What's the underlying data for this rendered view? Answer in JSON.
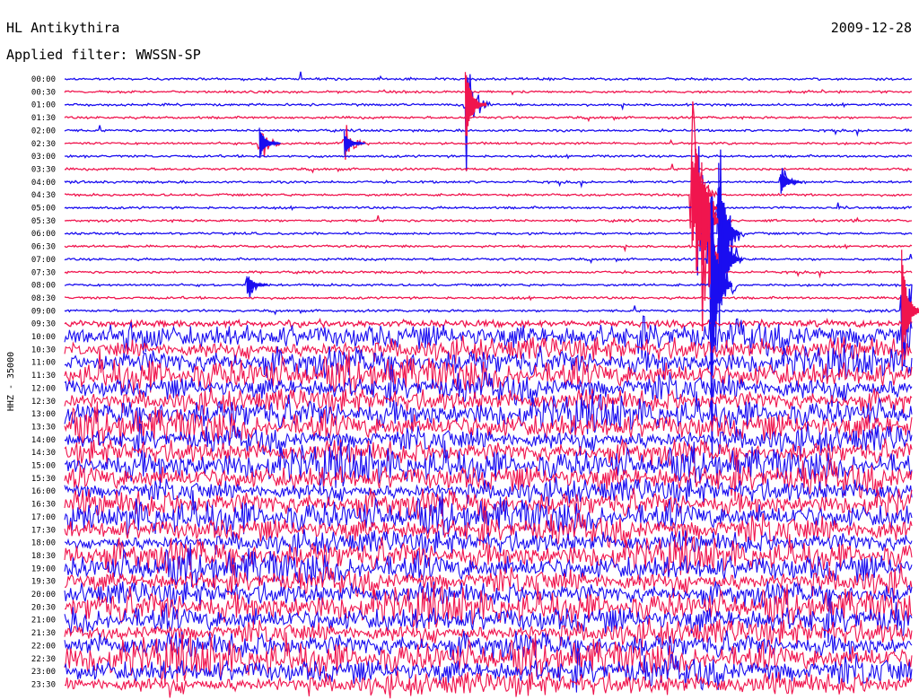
{
  "header": {
    "station": "HL Antikythira",
    "date": "2009-12-28",
    "filter": "Applied filter: WWSSN-SP"
  },
  "chart_data": {
    "type": "line",
    "subtype": "helicorder",
    "ylabel": "HHZ - 35000",
    "tick_labels": [
      "00:00",
      "00:30",
      "01:00",
      "01:30",
      "02:00",
      "02:30",
      "03:00",
      "03:30",
      "04:00",
      "04:30",
      "05:00",
      "05:30",
      "06:00",
      "06:30",
      "07:00",
      "07:30",
      "08:00",
      "08:30",
      "09:00",
      "09:30",
      "10:00",
      "10:30",
      "11:00",
      "11:30",
      "12:00",
      "12:30",
      "13:00",
      "13:30",
      "14:00",
      "14:30",
      "15:00",
      "15:30",
      "16:00",
      "16:30",
      "17:00",
      "17:30",
      "18:00",
      "18:30",
      "19:00",
      "19:30",
      "20:00",
      "20:30",
      "21:00",
      "21:30",
      "22:00",
      "22:30",
      "23:00",
      "23:30"
    ],
    "minutes_per_line": 30,
    "colors": [
      "#1a0df0",
      "#f0154e"
    ],
    "noise_increase_after": "09:30",
    "events": [
      {
        "line": "01:00",
        "pos": 0.473,
        "amp": 3.5,
        "color": "#f0154e"
      },
      {
        "line": "02:30",
        "pos": 0.23,
        "amp": 1.4,
        "color": "#1a0df0"
      },
      {
        "line": "02:30",
        "pos": 0.33,
        "amp": 1.1,
        "color": "#1a0df0"
      },
      {
        "line": "05:00",
        "pos": 0.745,
        "amp": 6.5,
        "color": "#f0154e"
      },
      {
        "line": "04:30",
        "pos": 0.74,
        "amp": 5.0,
        "color": "#f0154e"
      },
      {
        "line": "05:30",
        "pos": 0.752,
        "amp": 5.5,
        "color": "#f0154e"
      },
      {
        "line": "07:00",
        "pos": 0.76,
        "amp": 3.0,
        "color": "#f0154e"
      },
      {
        "line": "08:00",
        "pos": 0.763,
        "amp": 8.5,
        "color": "#1a0df0"
      },
      {
        "line": "06:00",
        "pos": 0.772,
        "amp": 7.0,
        "color": "#1a0df0"
      },
      {
        "line": "07:00",
        "pos": 0.775,
        "amp": 4.0,
        "color": "#1a0df0"
      },
      {
        "line": "08:00",
        "pos": 0.215,
        "amp": 1.0,
        "color": "#1a0df0"
      },
      {
        "line": "04:00",
        "pos": 0.845,
        "amp": 1.0,
        "color": "#1a0df0"
      },
      {
        "line": "09:00",
        "pos": 0.988,
        "amp": 5.0,
        "color": "#f0154e"
      }
    ]
  }
}
